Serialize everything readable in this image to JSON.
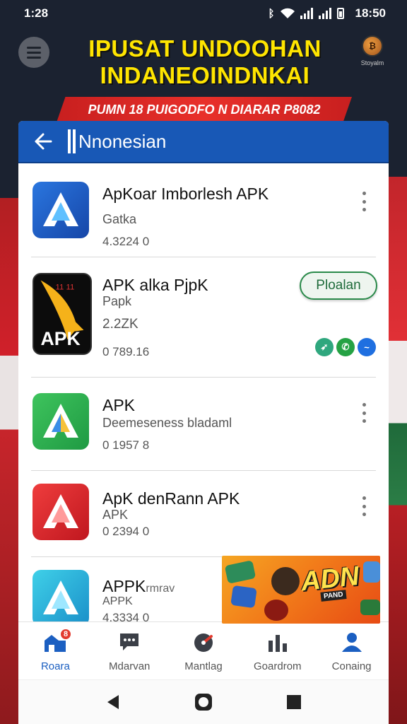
{
  "status_bar": {
    "time": "1:28",
    "clock_right": "18:50"
  },
  "banner": {
    "title_line1": "IPUSAT UNDOOHAN",
    "title_line2": "INDANEOINDNKAI",
    "promo": "PUMN 18 PUIGODFO N DIARAR P8082",
    "brand_text": "Stoyalm"
  },
  "header": {
    "title": "Nnonesian"
  },
  "apps": [
    {
      "name": "ApKoar Imborlesh APK",
      "subtitle": "Gatka",
      "size": "4.3224 0",
      "icon_color": "#1f63c9",
      "icon": "apk-logo-icon"
    },
    {
      "name": "APK alka PjpK",
      "subtitle": "Papk",
      "size": "2.2ZK",
      "extra": "0 789.16",
      "action": "Ploalan",
      "icon": "apk-bird-icon"
    },
    {
      "name": "APK",
      "subtitle": "Deemeseness bladaml",
      "size": "0 1957 8",
      "icon_color": "#2eab4e",
      "icon": "apk-logo-icon"
    },
    {
      "name": "ApK denRann APK",
      "subtitle": "APK",
      "size": "0 2394 0",
      "icon_color": "#d9262c",
      "icon": "apk-logo-icon"
    },
    {
      "name": "APPK",
      "name_suffix": "rmrav",
      "subtitle": "APPK",
      "size": "4.3334 0",
      "icon_color": "#27b3d6",
      "icon": "apk-logo-icon"
    }
  ],
  "ad": {
    "logo": "ADN",
    "tag": "PAND"
  },
  "bottom_nav": [
    {
      "label": "Roara",
      "icon": "home-icon",
      "badge": "8"
    },
    {
      "label": "Mdarvan",
      "icon": "chat-icon"
    },
    {
      "label": "Mantlag",
      "icon": "gauge-icon"
    },
    {
      "label": "Goardrom",
      "icon": "chart-icon"
    },
    {
      "label": "Conaing",
      "icon": "user-icon"
    }
  ],
  "colors": {
    "header_blue": "#1858b6",
    "banner_yellow": "#ffe500",
    "ribbon_red": "#e8302a",
    "install_green": "#2a8a4a"
  }
}
